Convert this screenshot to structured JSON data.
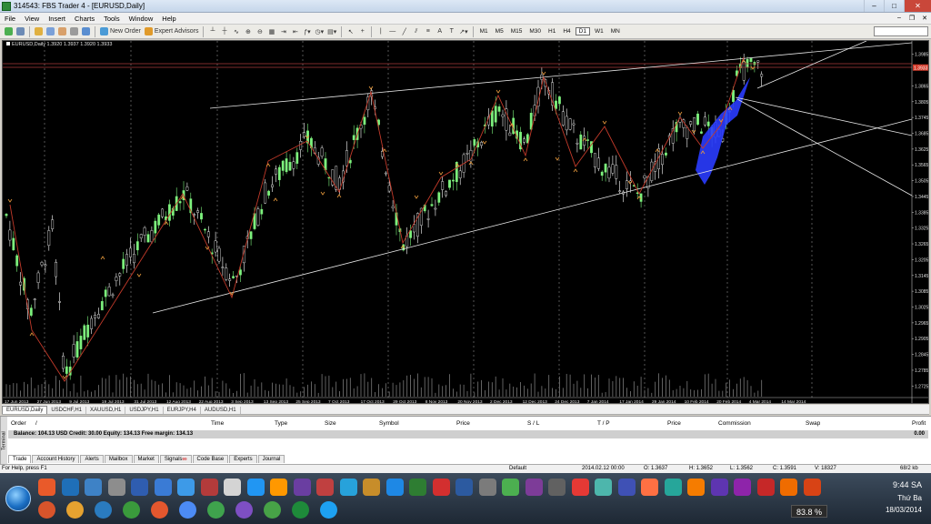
{
  "window": {
    "title": "314543: FBS Trader 4 - [EURUSD,Daily]"
  },
  "menu": {
    "items": [
      "File",
      "View",
      "Insert",
      "Charts",
      "Tools",
      "Window",
      "Help"
    ]
  },
  "toolbar": {
    "new_order": "New Order",
    "expert_advisors": "Expert Advisors",
    "timeframes": [
      "M1",
      "M5",
      "M15",
      "M30",
      "H1",
      "H4",
      "D1",
      "W1",
      "MN"
    ],
    "active_timeframe": "D1"
  },
  "chart": {
    "caption": "EURUSD,Daily  1.3920 1.3937 1.3920 1.3933",
    "price_labels": [
      "1.3985",
      "1.3933",
      "1.3865",
      "1.3805",
      "1.3745",
      "1.3685",
      "1.3625",
      "1.3565",
      "1.3505",
      "1.3445",
      "1.3385",
      "1.3325",
      "1.3265",
      "1.3205",
      "1.3145",
      "1.3085",
      "1.3025",
      "1.2965",
      "1.2905",
      "1.2845",
      "1.2785",
      "1.2725"
    ],
    "date_labels": [
      "17 Jun 2013",
      "27 Jun 2013",
      "9 Jul 2013",
      "19 Jul 2013",
      "31 Jul 2013",
      "12 Aug 2013",
      "22 Aug 2013",
      "3 Sep 2013",
      "13 Sep 2013",
      "25 Sep 2013",
      "7 Oct 2013",
      "17 Oct 2013",
      "29 Oct 2013",
      "8 Nov 2013",
      "20 Nov 2013",
      "2 Dec 2013",
      "12 Dec 2013",
      "24 Dec 2013",
      "7 Jan 2014",
      "17 Jan 2014",
      "29 Jan 2014",
      "10 Feb 2014",
      "20 Feb 2014",
      "4 Mar 2014",
      "14 Mar 2014"
    ]
  },
  "chart_tabs": [
    "EURUSD,Daily",
    "USDCHF,H1",
    "XAUUSD,H1",
    "USDJPY,H1",
    "EURJPY,H4",
    "AUDUSD,H1"
  ],
  "terminal": {
    "side_label": "Terminal",
    "columns": [
      "Order",
      "/",
      "Time",
      "Type",
      "Size",
      "Symbol",
      "Price",
      "S / L",
      "T / P",
      "Price",
      "Commission",
      "Swap",
      "Profit"
    ],
    "balance": "Balance: 104.13 USD  Credit: 30.00  Equity: 134.13  Free margin: 134.13",
    "profit": "0.00",
    "tabs": [
      "Trade",
      "Account History",
      "Alerts",
      "Mailbox",
      "Market",
      "Signals",
      "Code Base",
      "Experts",
      "Journal"
    ],
    "signals_badge": "99",
    "active_tab": "Trade"
  },
  "status": {
    "help": "For Help, press F1",
    "profile": "Default",
    "datetime": "2014.02.12 00:00",
    "open": "O: 1.3637",
    "high": "H: 1.3652",
    "low": "L: 1.3562",
    "close": "C: 1.3591",
    "volume": "V: 18327",
    "traffic": "68/2 kb"
  },
  "taskbar": {
    "cpu": "83.8 %",
    "time": "9:44 SA",
    "day": "Thứ Ba",
    "date": "18/03/2014",
    "icons": [
      "firefox-like",
      "folder",
      "media-player",
      "browser-green",
      "firefox",
      "chrome",
      "reload",
      "viber",
      "utorrent",
      "fbs",
      "skype"
    ]
  },
  "colors": {
    "bull": "#7df27d",
    "bear": "#ffffff",
    "zigzag": "#c23a2a",
    "arrow": "#e89a3c",
    "trend": "#e6e6e6",
    "fill": "#2a3cff"
  }
}
